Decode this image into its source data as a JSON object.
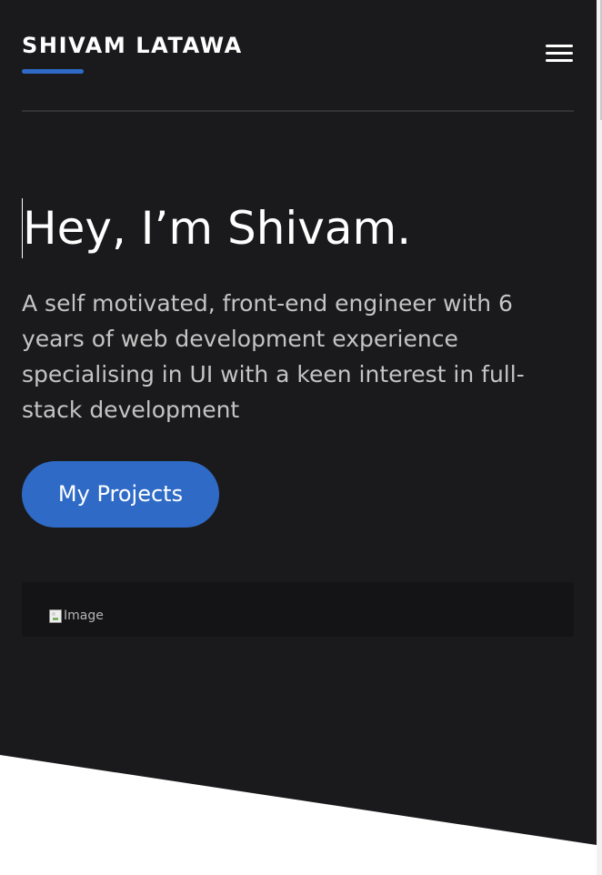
{
  "header": {
    "brand": "SHIVAM LATAWA",
    "accent_color": "#2f6bc6",
    "menu_icon": "hamburger-menu-icon"
  },
  "hero": {
    "headline": "Hey, I’m Shivam.",
    "intro": "A self motivated, front-end engineer with 6 years of web development experience specialising in UI with a keen interest in full-stack development",
    "cta_label": "My Projects",
    "background_color": "#1a1a1c"
  },
  "media": {
    "image_alt": "Image",
    "broken_image_icon": "broken-image-icon"
  }
}
